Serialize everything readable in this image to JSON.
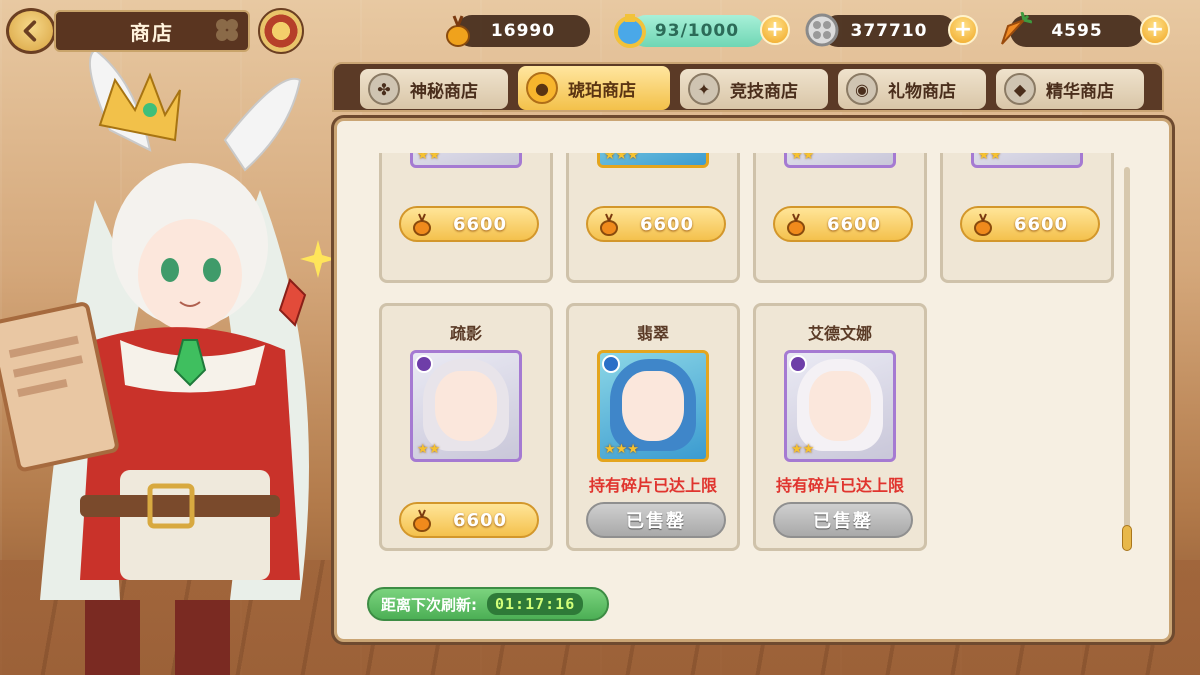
{
  "header": {
    "title": "商店"
  },
  "resources": [
    {
      "id": "amber",
      "value": "16990",
      "icon": "amber-icon",
      "has_plus": false
    },
    {
      "id": "stamina",
      "value": "93/1000",
      "icon": "potion-icon",
      "has_plus": true
    },
    {
      "id": "coin",
      "value": "377710",
      "icon": "coin-icon",
      "has_plus": true
    },
    {
      "id": "carrot",
      "value": "4595",
      "icon": "carrot-icon",
      "has_plus": true
    }
  ],
  "tabs": [
    {
      "label": "神秘商店",
      "icon": "clover-icon",
      "active": false
    },
    {
      "label": "琥珀商店",
      "icon": "amber-icon",
      "active": true
    },
    {
      "label": "竞技商店",
      "icon": "arena-icon",
      "active": false
    },
    {
      "label": "礼物商店",
      "icon": "gift-coin-icon",
      "active": false
    },
    {
      "label": "精华商店",
      "icon": "essence-icon",
      "active": false
    }
  ],
  "items_top": [
    {
      "price": "6600"
    },
    {
      "price": "6600"
    },
    {
      "price": "6600"
    },
    {
      "price": "6600"
    }
  ],
  "items_bottom": [
    {
      "name": "疏影",
      "price": "6600",
      "status": "available"
    },
    {
      "name": "翡翠",
      "status": "sold",
      "limit_text": "持有碎片已达上限",
      "sold_label": "已售罄"
    },
    {
      "name": "艾德文娜",
      "status": "sold",
      "limit_text": "持有碎片已达上限",
      "sold_label": "已售罄"
    }
  ],
  "refresh": {
    "label": "距离下次刷新:",
    "time": "01:17:16"
  },
  "colors": {
    "accent_gold": "#f4c14d",
    "sold_gray": "#a9a9a9",
    "limit_red": "#e0342e",
    "refresh_green": "#4caf55"
  }
}
